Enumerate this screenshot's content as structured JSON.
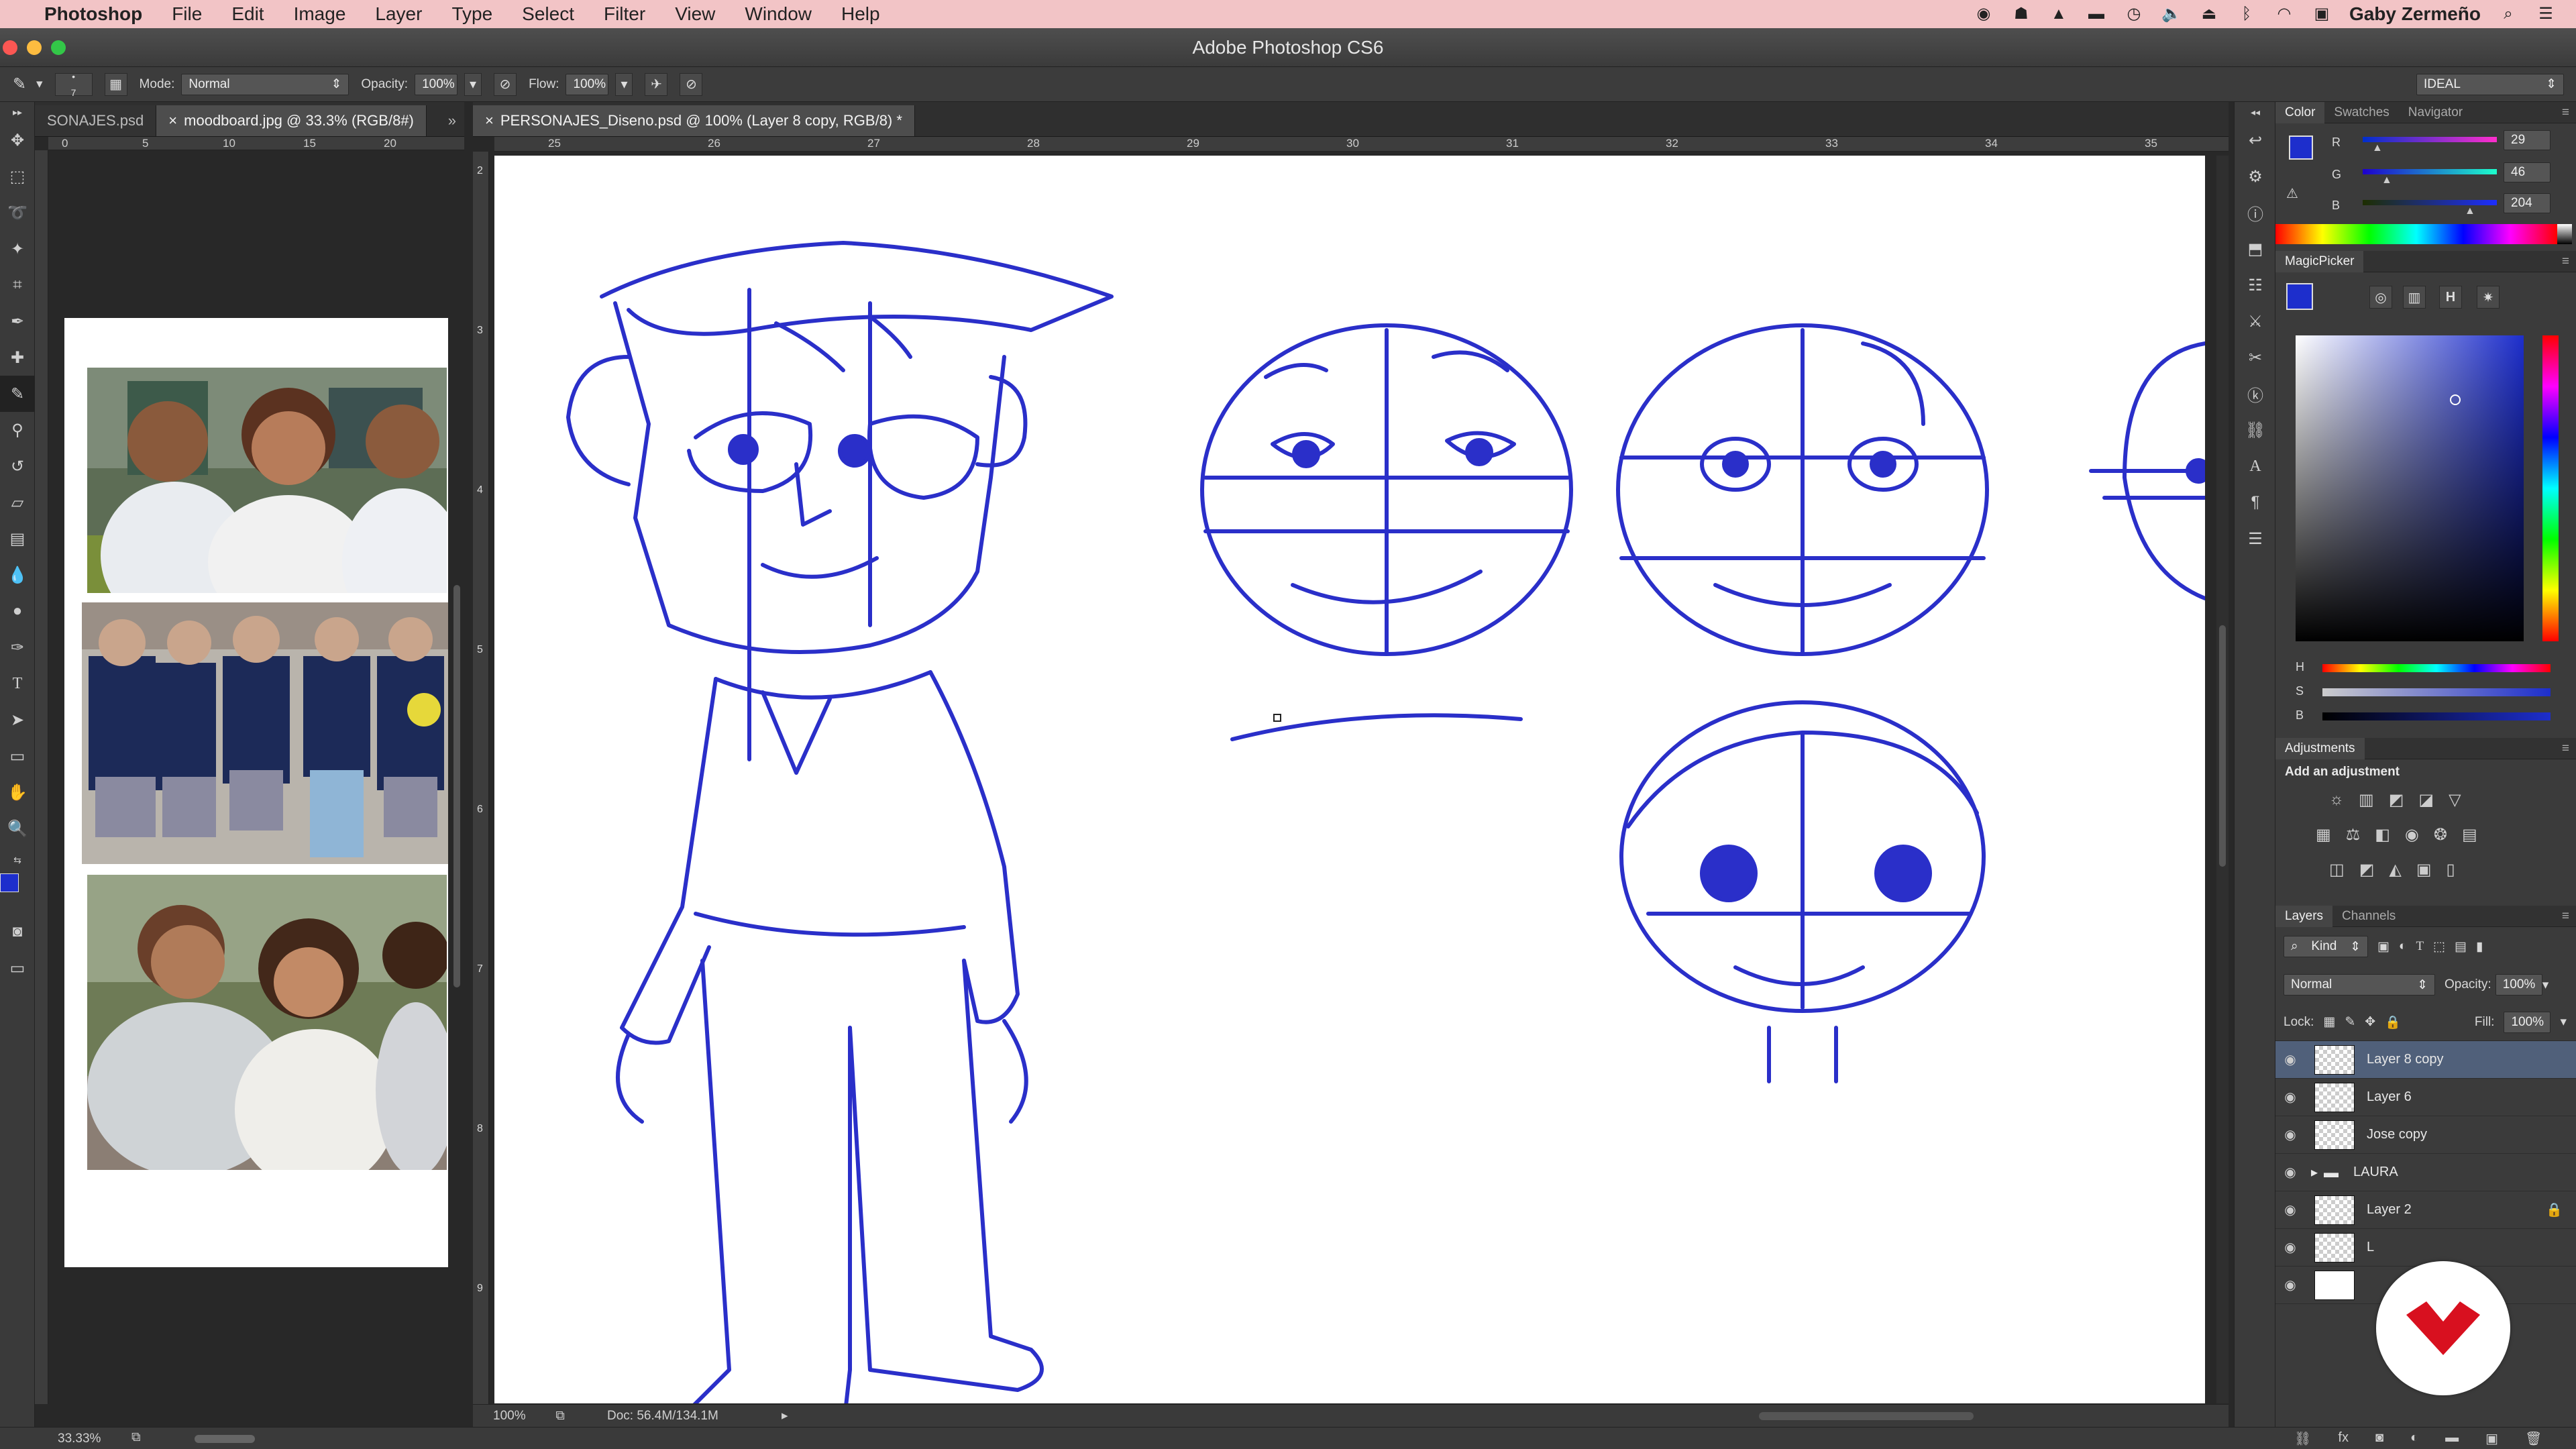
{
  "menubar": {
    "app": "Photoshop",
    "items": [
      "File",
      "Edit",
      "Image",
      "Layer",
      "Type",
      "Select",
      "Filter",
      "View",
      "Window",
      "Help"
    ],
    "user": "Gaby Zermeño"
  },
  "titlebar": {
    "title": "Adobe Photoshop CS6"
  },
  "options": {
    "brush_size": "7",
    "mode_label": "Mode:",
    "mode_value": "Normal",
    "opacity_label": "Opacity:",
    "opacity_value": "100%",
    "flow_label": "Flow:",
    "flow_value": "100%",
    "workspace": "IDEAL"
  },
  "moodboard": {
    "tab1": "SONAJES.psd",
    "tab2": "moodboard.jpg @ 33.3% (RGB/8#)",
    "ruler_ticks": [
      "0",
      "5",
      "10",
      "15",
      "20"
    ],
    "zoom": "33.33%"
  },
  "document": {
    "tab": "PERSONAJES_Diseno.psd @ 100% (Layer 8 copy, RGB/8) *",
    "ruler_ticks": [
      "25",
      "26",
      "27",
      "28",
      "29",
      "30",
      "31",
      "32",
      "33",
      "34",
      "35"
    ],
    "vruler_ticks": [
      "2",
      "3",
      "4",
      "5",
      "6",
      "7",
      "8",
      "9"
    ],
    "zoom": "100%",
    "doc_size": "Doc: 56.4M/134.1M"
  },
  "color_panel": {
    "tabs": [
      "Color",
      "Swatches",
      "Navigator"
    ],
    "r_label": "R",
    "g_label": "G",
    "b_label": "B",
    "r": "29",
    "g": "46",
    "b": "204",
    "r_level": 0.11,
    "g_level": 0.18,
    "b_level": 0.8,
    "fg_color": "#1d2ecc"
  },
  "magicpicker": {
    "title": "MagicPicker",
    "mode_button": "H",
    "h_label": "H",
    "s_label": "S",
    "b_label": "B"
  },
  "adjustments": {
    "title": "Adjustments",
    "subtitle": "Add an adjustment"
  },
  "layers_panel": {
    "tabs": [
      "Layers",
      "Channels"
    ],
    "kind": "Kind",
    "blend": "Normal",
    "opacity_label": "Opacity:",
    "opacity_value": "100%",
    "lock_label": "Lock:",
    "fill_label": "Fill:",
    "fill_value": "100%",
    "layers": [
      {
        "name": "Layer 8 copy"
      },
      {
        "name": "Layer 6"
      },
      {
        "name": "Jose copy"
      },
      {
        "name": "LAURA"
      },
      {
        "name": "Layer 2"
      },
      {
        "name": "L"
      },
      {
        "name": ""
      }
    ]
  },
  "colors": {
    "sketch": "#2a2fc9",
    "brand_red": "#d8101f"
  }
}
